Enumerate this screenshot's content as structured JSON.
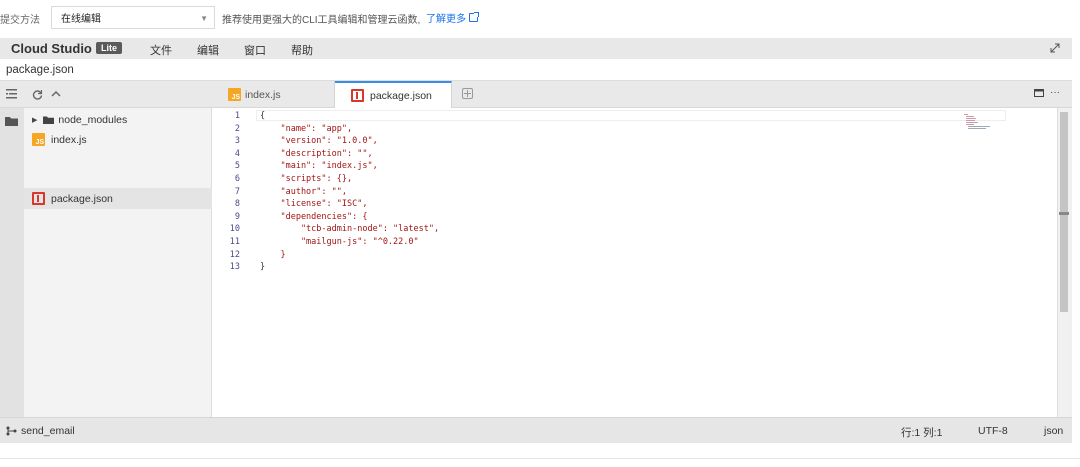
{
  "submit": {
    "label": "提交方法",
    "method_value": "在线编辑",
    "recommend_text": "推荐使用更强大的CLI工具编辑和管理云函数,",
    "learn_more": "了解更多"
  },
  "ide": {
    "brand": "Cloud Studio",
    "badge": "Lite",
    "menu": [
      "文件",
      "编辑",
      "窗口",
      "帮助"
    ],
    "file_path": "package.json",
    "tabs": [
      {
        "label": "index.js",
        "icon": "js-file-icon",
        "active": false
      },
      {
        "label": "package.json",
        "icon": "json-file-icon",
        "active": true
      }
    ],
    "tree": [
      {
        "label": "node_modules",
        "type": "folder"
      },
      {
        "label": "index.js",
        "type": "js"
      },
      {
        "label": "package.json",
        "type": "json",
        "selected": true
      }
    ],
    "code_lines": [
      "{",
      "    \"name\": \"app\",",
      "    \"version\": \"1.0.0\",",
      "    \"description\": \"\",",
      "    \"main\": \"index.js\",",
      "    \"scripts\": {},",
      "    \"author\": \"\",",
      "    \"license\": \"ISC\",",
      "    \"dependencies\": {",
      "        \"tcb-admin-node\": \"latest\",",
      "        \"mailgun-js\": \"^0.22.0\"",
      "    }",
      "}"
    ],
    "line_numbers": [
      "1",
      "2",
      "3",
      "4",
      "5",
      "6",
      "7",
      "8",
      "9",
      "10",
      "11",
      "12",
      "13"
    ]
  },
  "status": {
    "branch": "send_email",
    "position": "行:1 列:1",
    "encoding": "UTF-8",
    "language": "json"
  },
  "colors": {
    "accent": "#3a8ee6",
    "link": "#1a73e8",
    "js": "#f5a623",
    "json": "#d9362c",
    "string": "#a31515"
  }
}
